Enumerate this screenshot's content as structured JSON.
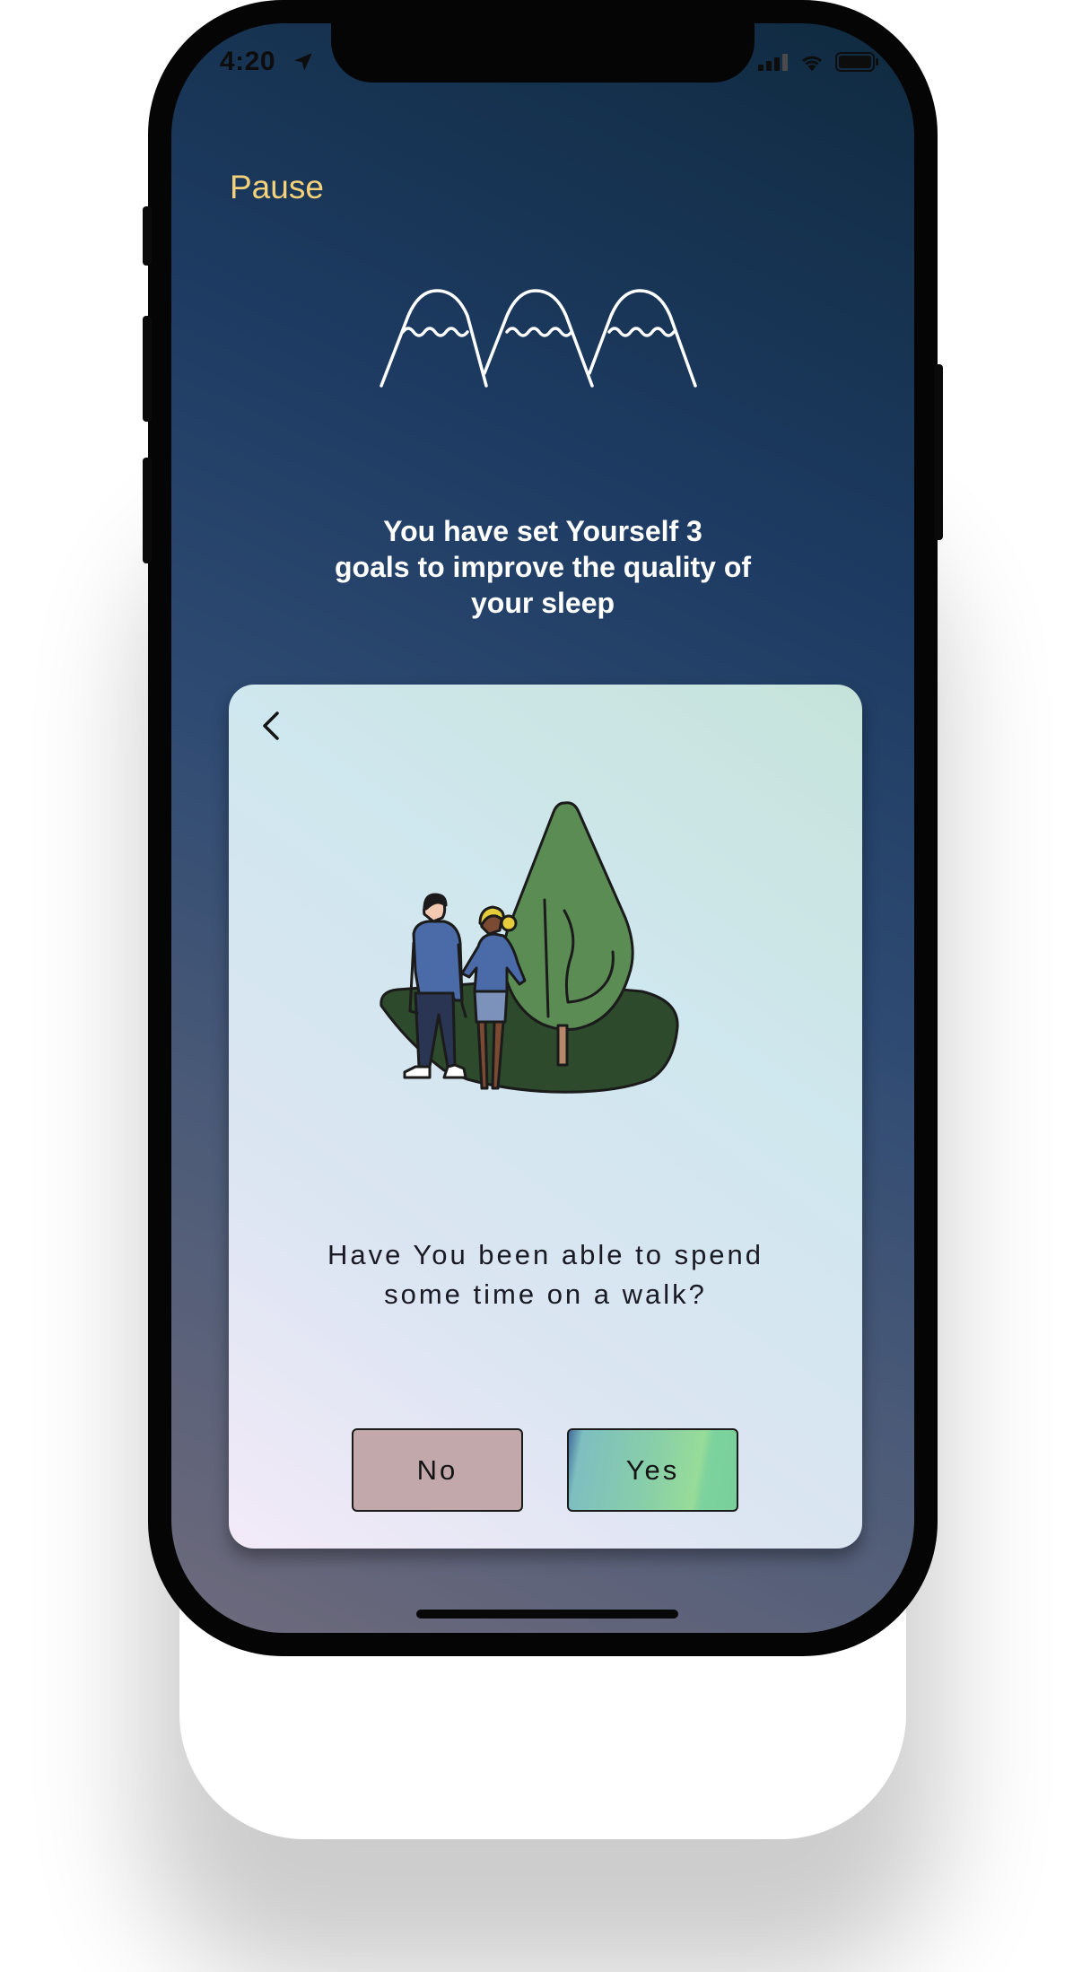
{
  "status_bar": {
    "time": "4:20"
  },
  "header": {
    "pause_label": "Pause"
  },
  "main": {
    "headline": "You have set Yourself 3\ngoals to improve the  quality of\nyour sleep"
  },
  "card": {
    "question": "Have You been able to spend\nsome time on a walk?",
    "no_label": "No",
    "yes_label": "Yes"
  },
  "icons": {
    "status_location": "location-arrow-icon",
    "status_signal": "cellular-signal-icon",
    "status_wifi": "wifi-icon",
    "status_battery": "battery-icon",
    "logo": "mountains-logo-icon",
    "back": "chevron-left-icon",
    "illustration": "couple-walking-tree-illustration"
  },
  "colors": {
    "pause_text": "#f3d27a",
    "no_button": "#c2a8aa",
    "yes_button": "#89cfa8",
    "headline_text": "#ffffff"
  }
}
